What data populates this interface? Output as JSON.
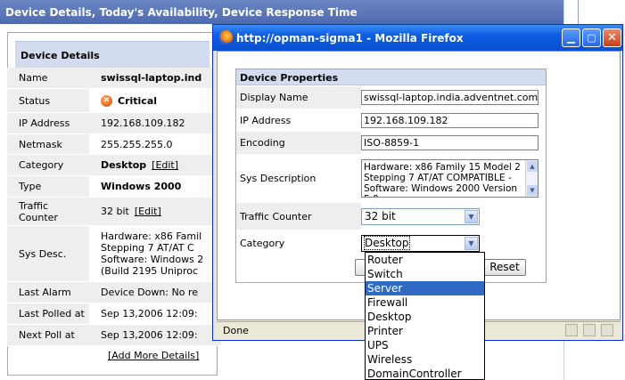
{
  "background_app": {
    "header_title": "Device Details, Today's Availability, Device Response Time",
    "panel_title": "Device Details",
    "rows": [
      {
        "label": "Name",
        "value": "swissql-laptop.ind"
      },
      {
        "label": "Status",
        "value": "Critical"
      },
      {
        "label": "IP Address",
        "value": "192.168.109.182"
      },
      {
        "label": "Netmask",
        "value": "255.255.255.0"
      },
      {
        "label": "Category",
        "value": "Desktop",
        "edit": "[Edit]"
      },
      {
        "label": "Type",
        "value": "Windows 2000"
      },
      {
        "label": "Traffic\nCounter",
        "value": "32 bit",
        "edit": "[Edit]"
      },
      {
        "label": "Sys Desc.",
        "value": "Hardware: x86 Famil\nStepping 7 AT/AT C\nSoftware: Windows 2\n(Build 2195 Uniproc"
      },
      {
        "label": "Last Alarm",
        "value": "Device Down: No re"
      },
      {
        "label": "Last Polled at",
        "value": "Sep 13,2006 12:09:"
      },
      {
        "label": "Next Poll at",
        "value": "Sep 13,2006 12:09:"
      }
    ],
    "add_more": "[Add More Details]"
  },
  "firefox": {
    "title": "http://opman-sigma1 - Mozilla Firefox",
    "status": "Done",
    "colors": {
      "titlebar": "#0b5de2",
      "highlight": "#316ac5"
    }
  },
  "props": {
    "title": "Device Properties",
    "display_name_label": "Display Name",
    "display_name_value": "swissql-laptop.india.adventnet.com",
    "ip_label": "IP Address",
    "ip_value": "192.168.109.182",
    "encoding_label": "Encoding",
    "encoding_value": "ISO-8859-1",
    "sysdesc_label": "Sys Description",
    "sysdesc_value": "Hardware: x86 Family 15 Model 2 Stepping 7 AT/AT COMPATIBLE - Software: Windows 2000 Version 5.0",
    "traffic_label": "Traffic Counter",
    "traffic_value": "32 bit",
    "category_label": "Category",
    "category_value": "Desktop",
    "reset_label": "Reset"
  },
  "dropdown": {
    "options": [
      "Router",
      "Switch",
      "Server",
      "Firewall",
      "Desktop",
      "Printer",
      "UPS",
      "Wireless",
      "DomainController"
    ],
    "highlighted": "Server"
  }
}
